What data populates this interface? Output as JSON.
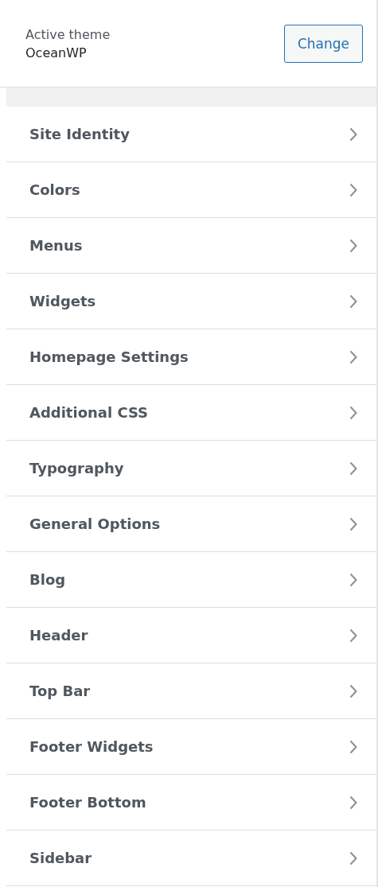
{
  "theme": {
    "label": "Active theme",
    "name": "OceanWP",
    "button": "Change"
  },
  "sections": [
    {
      "label": "Site Identity"
    },
    {
      "label": "Colors"
    },
    {
      "label": "Menus"
    },
    {
      "label": "Widgets"
    },
    {
      "label": "Homepage Settings"
    },
    {
      "label": "Additional CSS"
    },
    {
      "label": "Typography"
    },
    {
      "label": "General Options"
    },
    {
      "label": "Blog"
    },
    {
      "label": "Header"
    },
    {
      "label": "Top Bar"
    },
    {
      "label": "Footer Widgets"
    },
    {
      "label": "Footer Bottom"
    },
    {
      "label": "Sidebar"
    }
  ]
}
